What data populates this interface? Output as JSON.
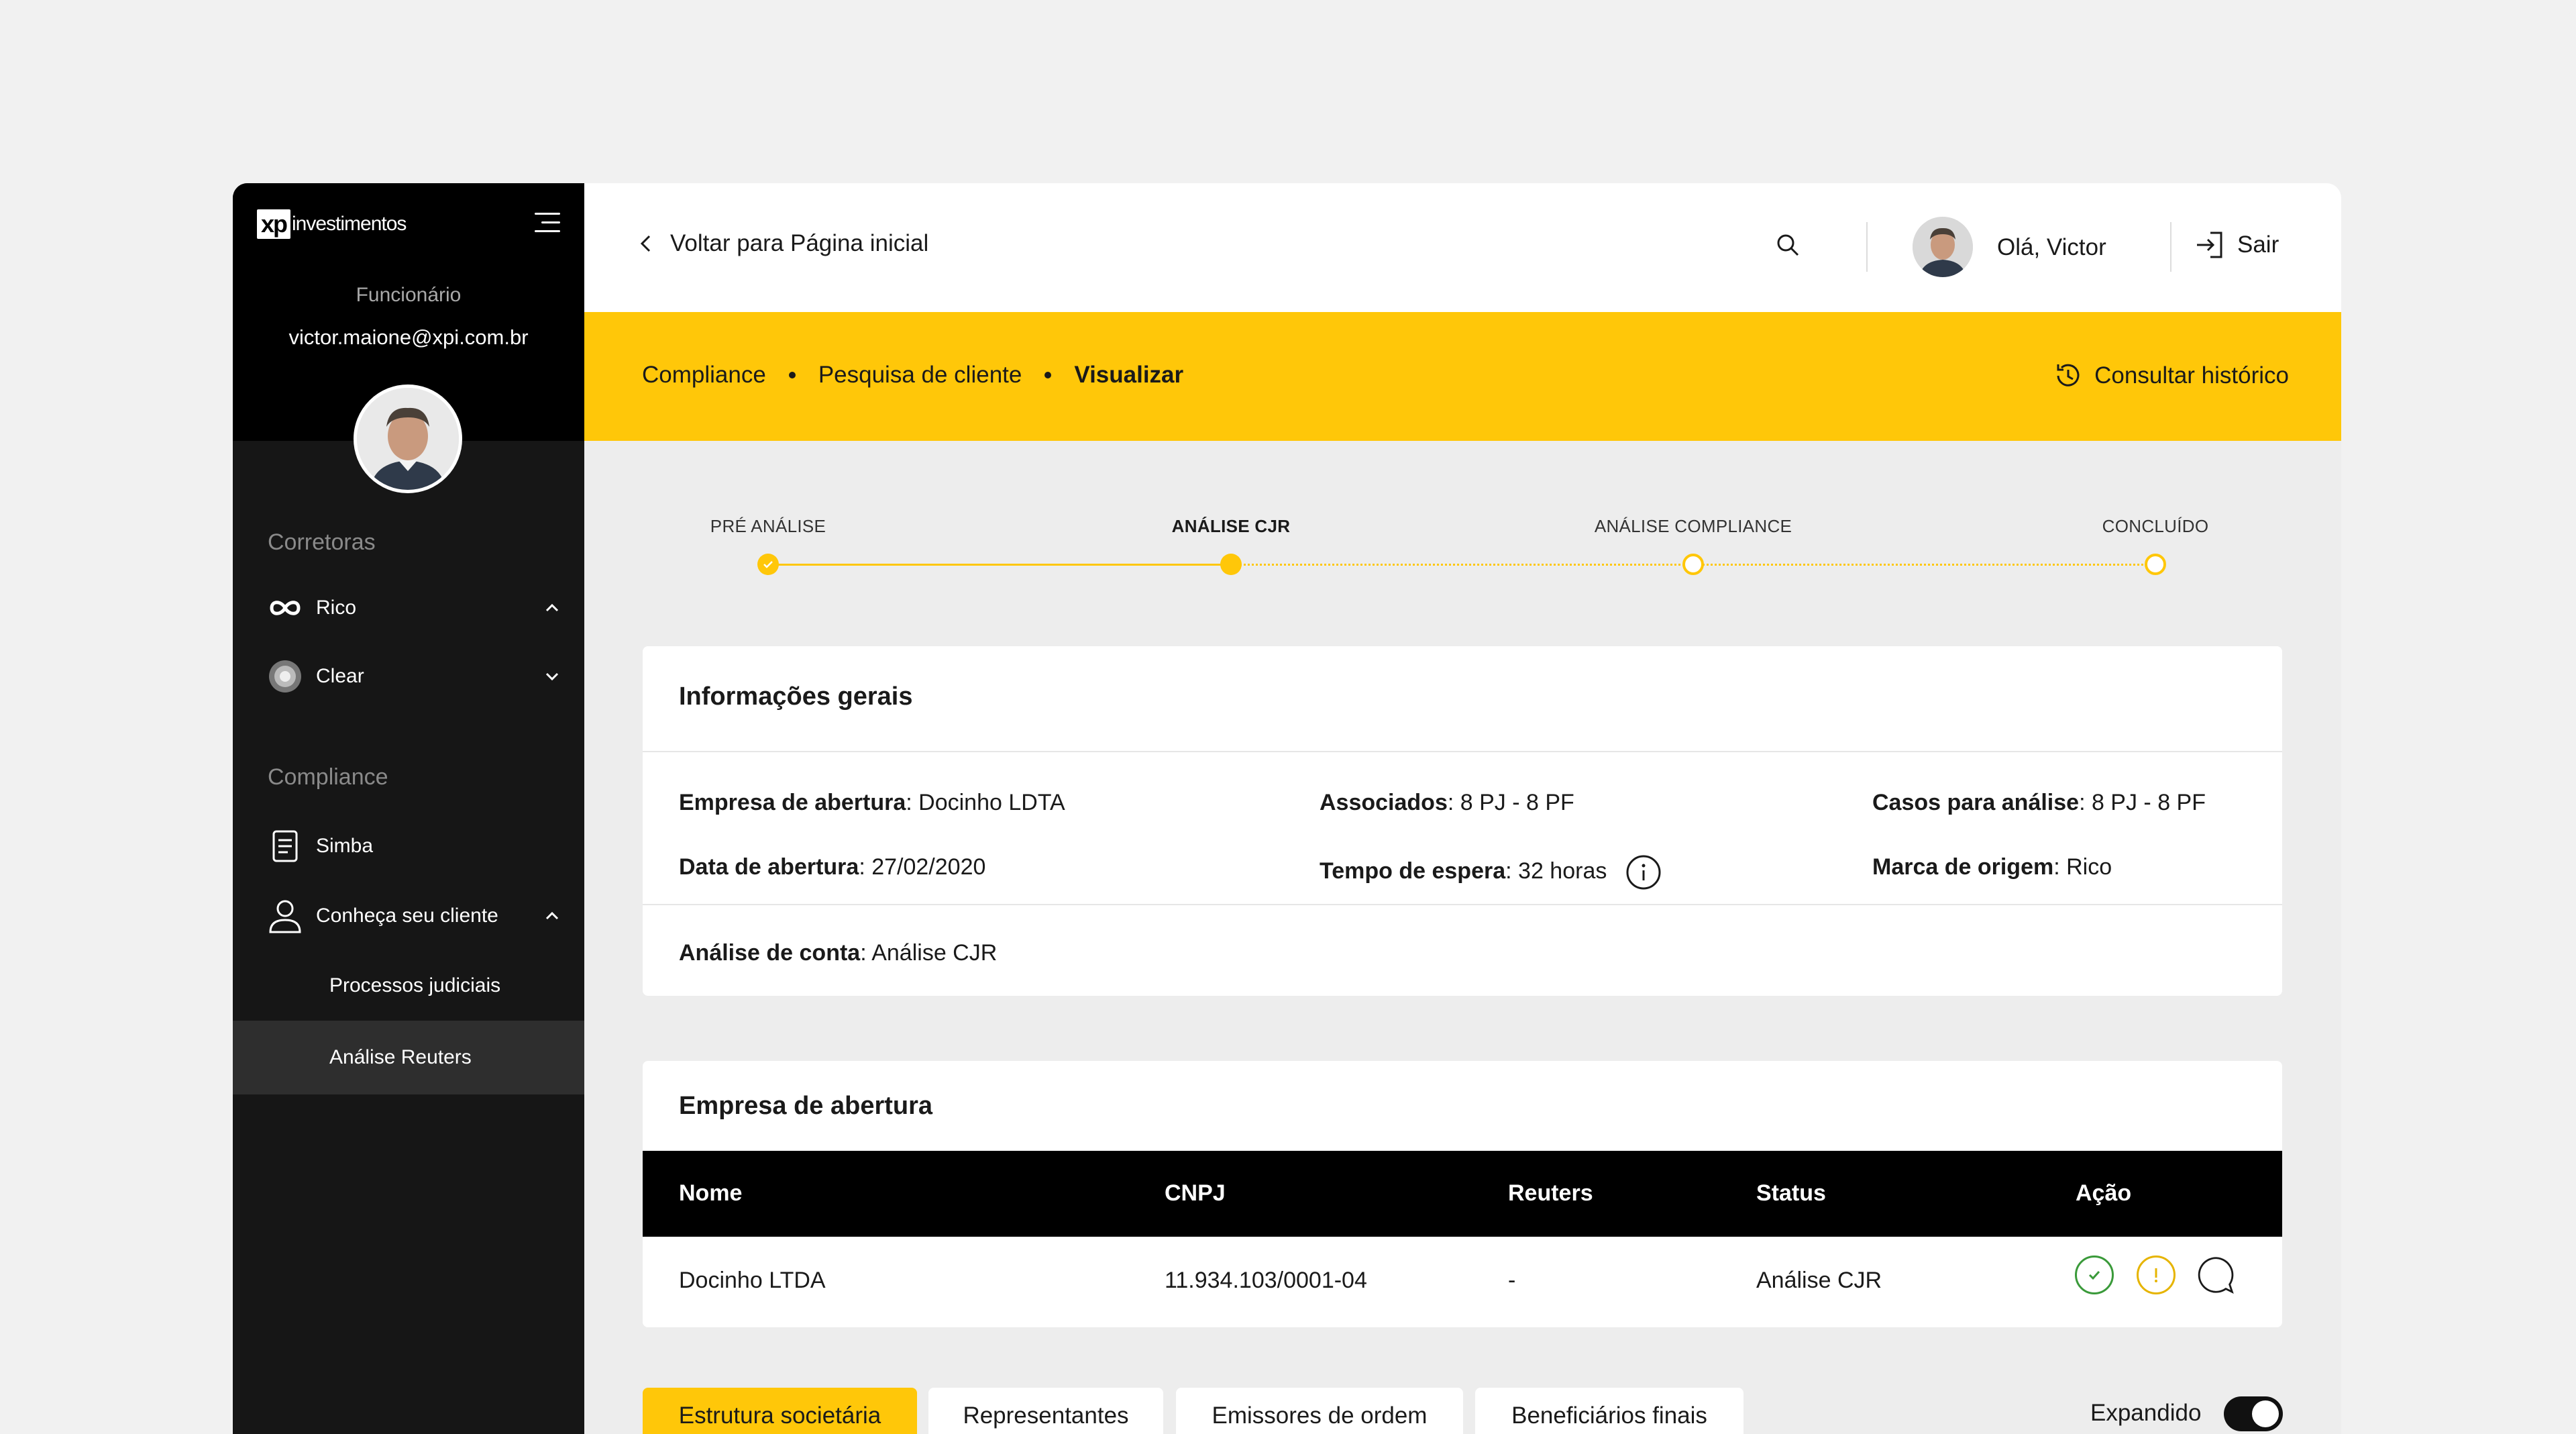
{
  "sidebar": {
    "logo_xp": "xp",
    "logo_text": "investimentos",
    "role": "Funcionário",
    "email": "victor.maione@xpi.com.br",
    "section_brokers": "Corretoras",
    "brokers": [
      {
        "label": "Rico",
        "icon": "infinity-icon",
        "expanded": true
      },
      {
        "label": "Clear",
        "icon": "clear-logo-icon",
        "expanded": false
      }
    ],
    "section_compliance": "Compliance",
    "compliance_items": [
      {
        "label": "Simba",
        "icon": "document-icon"
      },
      {
        "label": "Conheça seu cliente",
        "icon": "user-icon",
        "expanded": true
      }
    ],
    "sub_items": [
      {
        "label": "Processos judiciais",
        "active": false
      },
      {
        "label": "Análise Reuters",
        "active": true
      }
    ]
  },
  "header": {
    "back_label": "Voltar para Página inicial",
    "greeting": "Olá, Victor",
    "logout_label": "Sair"
  },
  "breadcrumb": {
    "items": [
      "Compliance",
      "Pesquisa de cliente",
      "Visualizar"
    ],
    "history_label": "Consultar histórico"
  },
  "stepper": {
    "steps": [
      {
        "label": "PRÉ ANÁLISE",
        "state": "done"
      },
      {
        "label": "ANÁLISE CJR",
        "state": "current"
      },
      {
        "label": "ANÁLISE COMPLIANCE",
        "state": "pending"
      },
      {
        "label": "CONCLUÍDO",
        "state": "pending"
      }
    ]
  },
  "general_info": {
    "title": "Informações gerais",
    "fields": {
      "empresa_label": "Empresa de abertura",
      "empresa_value": ": Docinho LDTA",
      "data_label": "Data de abertura",
      "data_value": ": 27/02/2020",
      "associados_label": "Associados",
      "associados_value": ": 8 PJ - 8 PF",
      "tempo_label": "Tempo de espera",
      "tempo_value": ": 32 horas",
      "casos_label": "Casos para análise",
      "casos_value": ": 8 PJ - 8 PF",
      "marca_label": "Marca de origem",
      "marca_value": ": Rico",
      "analise_label": "Análise de conta",
      "analise_value": ": Análise CJR"
    }
  },
  "company_table": {
    "title": "Empresa de abertura",
    "columns": [
      "Nome",
      "CNPJ",
      "Reuters",
      "Status",
      "Ação"
    ],
    "rows": [
      {
        "nome": "Docinho LTDA",
        "cnpj": "11.934.103/0001-04",
        "reuters": "-",
        "status": "Análise CJR"
      }
    ]
  },
  "tabs": [
    "Estrutura societária",
    "Representantes",
    "Emissores de ordem",
    "Beneficiários finais"
  ],
  "toggle": {
    "label": "Expandido",
    "on": true
  },
  "colors": {
    "accent": "#ffc709",
    "dark": "#000000",
    "success": "#3a9a3a",
    "warning": "#e6b400"
  }
}
